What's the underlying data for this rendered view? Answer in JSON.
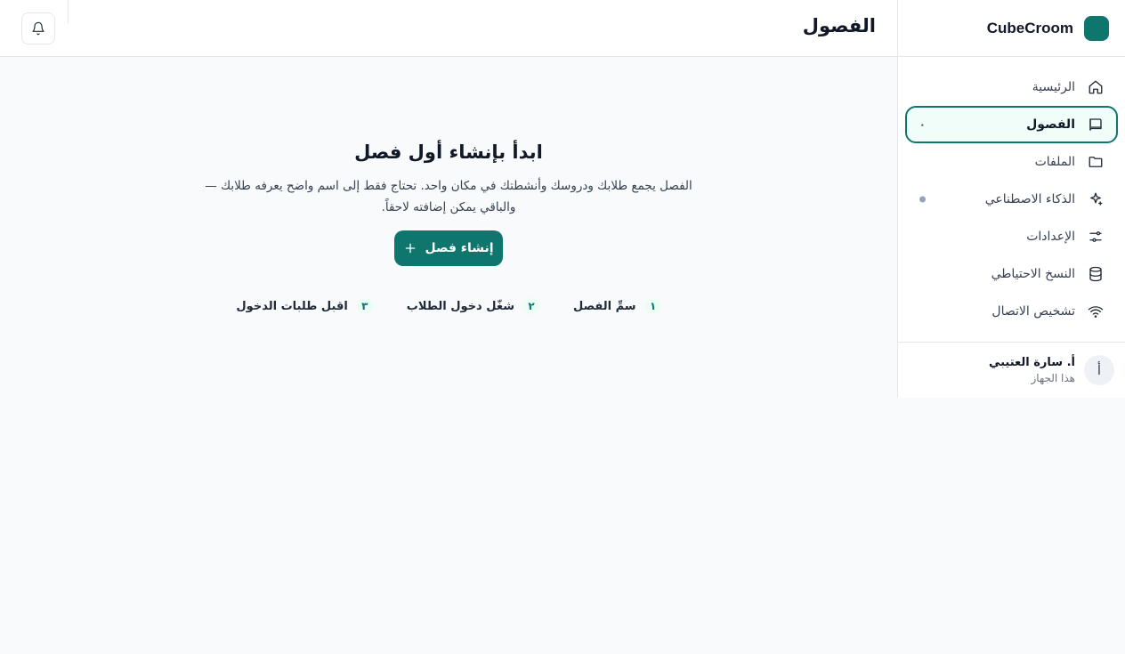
{
  "brand": {
    "name": "CubeCroom",
    "accent": "#0f766e"
  },
  "header": {
    "title": "الفصول",
    "bell_icon": "bell-icon"
  },
  "sidebar": {
    "items": [
      {
        "label": "الرئيسية",
        "icon": "home-icon",
        "active": false
      },
      {
        "label": "الفصول",
        "icon": "book-icon",
        "active": true,
        "badge": "٠"
      },
      {
        "label": "الملفات",
        "icon": "folder-icon",
        "active": false
      },
      {
        "label": "الذكاء الاصطناعي",
        "icon": "sparkles-icon",
        "active": false,
        "dot": true
      },
      {
        "label": "الإعدادات",
        "icon": "sliders-icon",
        "active": false
      },
      {
        "label": "النسخ الاحتياطي",
        "icon": "database-icon",
        "active": false
      },
      {
        "label": "تشخيص الاتصال",
        "icon": "wifi-icon",
        "active": false
      }
    ]
  },
  "user": {
    "avatar_letter": "أ",
    "name": "أ. سارة العتيبي",
    "subtitle": "هذا الجهاز"
  },
  "empty_state": {
    "title": "ابدأ بإنشاء أول فصل",
    "description": "الفصل يجمع طلابك ودروسك وأنشطتك في مكان واحد. تحتاج فقط إلى اسم واضح يعرفه طلابك — والباقي يمكن إضافته لاحقاً.",
    "button_label": "إنشاء فصل",
    "steps": [
      {
        "num": "١",
        "label": "سمِّ الفصل"
      },
      {
        "num": "٢",
        "label": "شغّل دخول الطلاب"
      },
      {
        "num": "٣",
        "label": "اقبل طلبات الدخول"
      }
    ]
  }
}
